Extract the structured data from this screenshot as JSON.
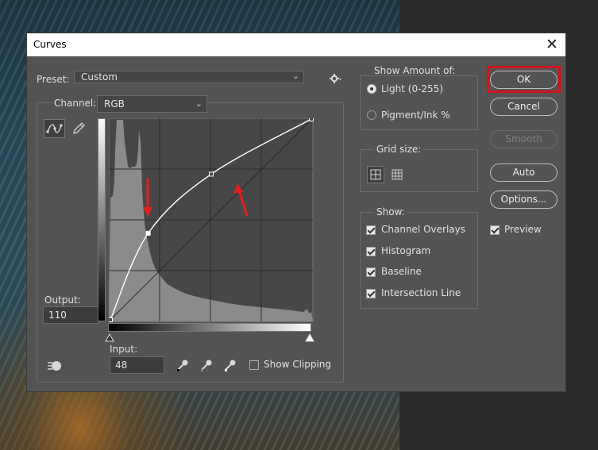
{
  "window": {
    "title": "Curves",
    "close_glyph": "✕"
  },
  "preset": {
    "label": "Preset:",
    "value": "Custom"
  },
  "channel": {
    "label": "Channel:",
    "value": "RGB"
  },
  "output": {
    "label": "Output:",
    "value": "110"
  },
  "input": {
    "label": "Input:",
    "value": "48"
  },
  "show_clipping": {
    "label": "Show Clipping",
    "checked": false
  },
  "show_amount": {
    "title": "Show Amount of:",
    "options": [
      {
        "label": "Light  (0-255)",
        "selected": true
      },
      {
        "label": "Pigment/Ink %",
        "selected": false
      }
    ]
  },
  "grid_size": {
    "title": "Grid size:",
    "selected": "simple"
  },
  "show": {
    "title": "Show:",
    "items": [
      {
        "label": "Channel Overlays",
        "checked": true
      },
      {
        "label": "Histogram",
        "checked": true
      },
      {
        "label": "Baseline",
        "checked": true
      },
      {
        "label": "Intersection Line",
        "checked": true
      }
    ]
  },
  "buttons": {
    "ok": "OK",
    "cancel": "Cancel",
    "smooth": "Smooth",
    "auto": "Auto",
    "options": "Options..."
  },
  "preview": {
    "label": "Preview",
    "checked": true
  },
  "curve": {
    "points": [
      [
        0,
        0
      ],
      [
        48,
        110
      ],
      [
        128,
        185
      ],
      [
        255,
        255
      ]
    ],
    "selected_point": [
      48,
      110
    ]
  },
  "colors": {
    "dialog_bg": "#535353",
    "accent_highlight": "#d0141b",
    "annotation_arrow": "#e02020"
  },
  "icons": {
    "curve_tool": "curve-point-icon",
    "pencil_tool": "pencil-icon",
    "settings": "gear-icon",
    "black_eyedropper": "eyedropper-black-icon",
    "gray_eyedropper": "eyedropper-gray-icon",
    "white_eyedropper": "eyedropper-white-icon",
    "target_adjust": "target-hand-icon"
  }
}
